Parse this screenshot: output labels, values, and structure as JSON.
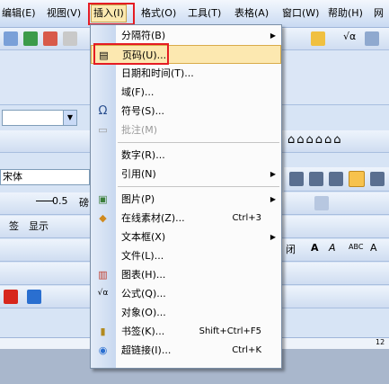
{
  "menubar": {
    "items": [
      {
        "label": "编辑(E)"
      },
      {
        "label": "视图(V)"
      },
      {
        "label": "插入(I)"
      },
      {
        "label": "格式(O)"
      },
      {
        "label": "工具(T)"
      },
      {
        "label": "表格(A)"
      },
      {
        "label": "窗口(W)"
      },
      {
        "label": "帮助(H)"
      },
      {
        "label": "网"
      }
    ],
    "active_index": 2
  },
  "toolbar": {
    "font_name": "宋体",
    "line_width": "0.5",
    "line_unit": "磅",
    "display_label": "显示",
    "zoom_icon_text": "√α",
    "font_a_text": "A",
    "abc_text": "ABC",
    "close_text": "闭",
    "ruler_number": "12"
  },
  "insert_menu": {
    "items": [
      {
        "label": "分隔符(B)",
        "icon": "",
        "shortcut": "",
        "submenu": true,
        "disabled": false
      },
      {
        "label": "页码(U)...",
        "icon": "page-number-icon",
        "shortcut": "",
        "submenu": false,
        "disabled": false
      },
      {
        "label": "日期和时间(T)...",
        "icon": "",
        "shortcut": "",
        "submenu": false,
        "disabled": false
      },
      {
        "label": "域(F)...",
        "icon": "",
        "shortcut": "",
        "submenu": false,
        "disabled": false
      },
      {
        "label": "符号(S)...",
        "icon": "omega-icon",
        "shortcut": "",
        "submenu": false,
        "disabled": false
      },
      {
        "label": "批注(M)",
        "icon": "comment-icon",
        "shortcut": "",
        "submenu": false,
        "disabled": true
      },
      {
        "label": "数字(R)...",
        "icon": "",
        "shortcut": "",
        "submenu": false,
        "disabled": false
      },
      {
        "label": "引用(N)",
        "icon": "",
        "shortcut": "",
        "submenu": true,
        "disabled": false
      },
      {
        "label": "图片(P)",
        "icon": "picture-icon",
        "shortcut": "",
        "submenu": true,
        "disabled": false
      },
      {
        "label": "在线素材(Z)...",
        "icon": "online-material-icon",
        "shortcut": "Ctrl+3",
        "submenu": false,
        "disabled": false
      },
      {
        "label": "文本框(X)",
        "icon": "",
        "shortcut": "",
        "submenu": true,
        "disabled": false
      },
      {
        "label": "文件(L)...",
        "icon": "",
        "shortcut": "",
        "submenu": false,
        "disabled": false
      },
      {
        "label": "图表(H)...",
        "icon": "chart-icon",
        "shortcut": "",
        "submenu": false,
        "disabled": false
      },
      {
        "label": "公式(Q)...",
        "icon": "formula-icon",
        "shortcut": "",
        "submenu": false,
        "disabled": false
      },
      {
        "label": "对象(O)...",
        "icon": "",
        "shortcut": "",
        "submenu": false,
        "disabled": false
      },
      {
        "label": "书签(K)...",
        "icon": "bookmark-icon",
        "shortcut": "Shift+Ctrl+F5",
        "submenu": false,
        "disabled": false
      },
      {
        "label": "超链接(I)...",
        "icon": "hyperlink-icon",
        "shortcut": "Ctrl+K",
        "submenu": false,
        "disabled": false
      }
    ],
    "highlighted_index": 1
  },
  "colors": {
    "highlight_border": "#e51c23",
    "menu_hover": "#fce8b0"
  }
}
